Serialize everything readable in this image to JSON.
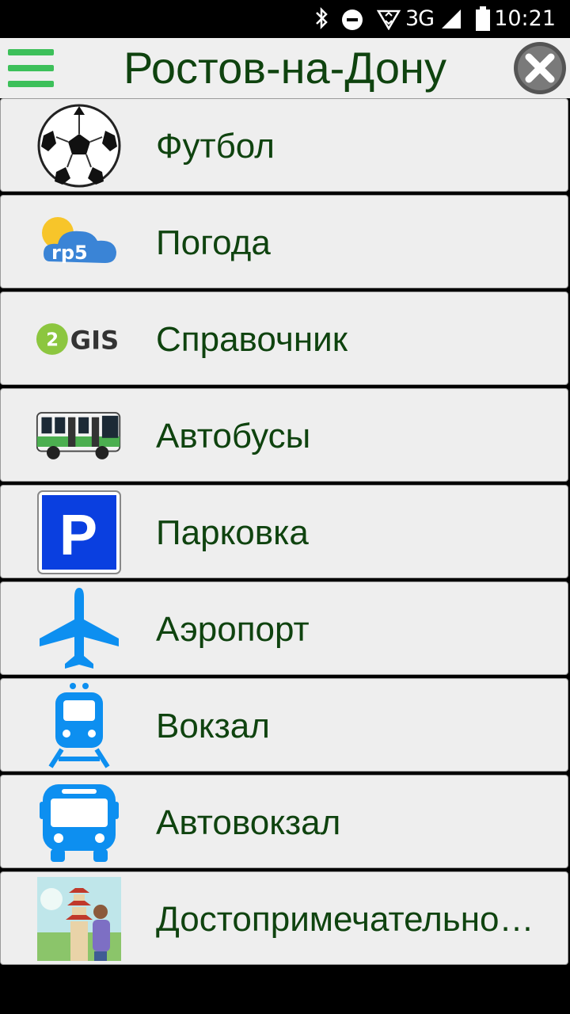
{
  "status": {
    "network": "3G",
    "time": "10:21"
  },
  "header": {
    "title": "Ростов-на-Дону"
  },
  "items": [
    {
      "label": "Футбол",
      "icon": "soccer-ball-icon"
    },
    {
      "label": "Погода",
      "icon": "rp5-weather-icon",
      "icon_text": "rp5"
    },
    {
      "label": "Справочник",
      "icon": "2gis-icon",
      "icon_text": "GIS",
      "icon_badge": "2"
    },
    {
      "label": "Автобусы",
      "icon": "bus-icon"
    },
    {
      "label": "Парковка",
      "icon": "parking-sign-icon",
      "icon_text": "P"
    },
    {
      "label": "Аэропорт",
      "icon": "airplane-icon"
    },
    {
      "label": "Вокзал",
      "icon": "train-icon"
    },
    {
      "label": "Автовокзал",
      "icon": "bus-station-icon"
    },
    {
      "label": "Достопримечательно…",
      "icon": "sights-icon"
    }
  ],
  "colors": {
    "title": "#0f430f",
    "menu": "#3dc05a",
    "row_bg": "#eeeeee"
  }
}
